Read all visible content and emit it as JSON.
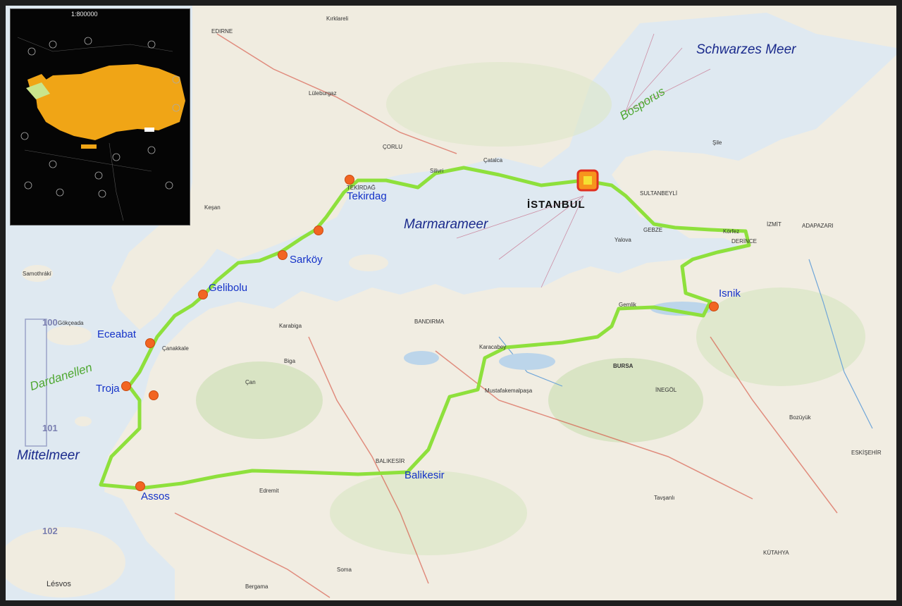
{
  "inset": {
    "scale": "1:800000"
  },
  "water_bodies": {
    "black_sea": "Schwarzes Meer",
    "marmara": "Marmarameer",
    "mediterranean": "Mittelmeer"
  },
  "straits": {
    "bosporus": "Bosporus",
    "dardanelles": "Dardanellen"
  },
  "capital": "İSTANBUL",
  "route_stops": [
    "Tekirdag",
    "Sarköy",
    "Gelibolu",
    "Eceabat",
    "Troja",
    "Assos",
    "Balikesir",
    "Isnik"
  ],
  "towns": {
    "edirne": "EDIRNE",
    "kirklareli": "Kırklareli",
    "luleburgaz": "Lüleburgaz",
    "corlu": "ÇORLU",
    "silivri": "Silivri",
    "catalca": "Çatalca",
    "tekirdag_small": "TEKİRDAĞ",
    "kesan": "Keşan",
    "canakkale": "Çanakkale",
    "bandirma": "BANDIRMA",
    "bursa": "BURSA",
    "inegol": "İNEGÖL",
    "izmit": "İZMİT",
    "adapazari": "ADAPAZARI",
    "derince": "DERİNCE",
    "gebze": "GEBZE",
    "yalova": "Yalova",
    "gemlik": "Gemlik",
    "sultanbeyli": "SULTANBEYLİ",
    "sile": "Şile",
    "karabiga": "Karabiga",
    "biga": "Biga",
    "can": "Çan",
    "balikesir_small": "BALIKESİR",
    "mustafakemalpasa": "Mustafakemalpaşa",
    "bergama": "Bergama",
    "soma": "Soma",
    "kutahya": "KÜTAHYA",
    "eskisehir": "ESKİŞEHİR",
    "lesvos": "Lésvos",
    "samothraki": "Samothrákí",
    "gokceada": "Gökçeada",
    "edremit": "Edremit",
    "tavsanli": "Tavşanlı",
    "karacabey": "Karacabey",
    "korfez": "Körfez",
    "bozuyuk": "Bozüyük"
  },
  "sheet_numbers": [
    "100",
    "101",
    "102"
  ],
  "colors": {
    "route": "#8ee03c",
    "stop": "#f26522",
    "water": "#dfe9f1",
    "land": "#f1ede2",
    "capital_marker": "#f7941d"
  }
}
